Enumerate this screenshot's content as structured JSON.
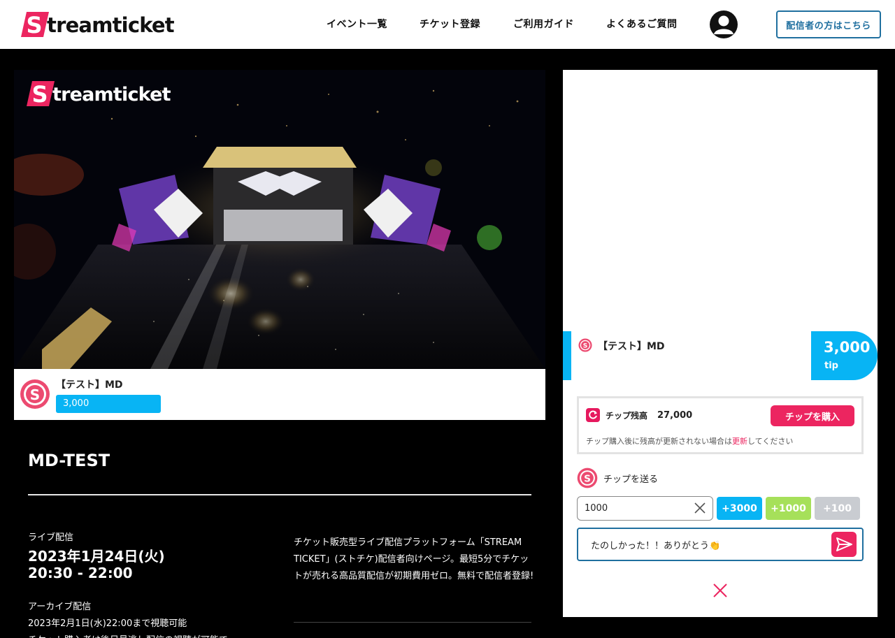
{
  "header": {
    "logo_text": "treamticket",
    "nav": [
      "イベント一覧",
      "チケット登録",
      "ご利用ガイド",
      "よくあるご質問"
    ],
    "cta_label": "配信者の方はこちら"
  },
  "video": {
    "logo_text": "treamticket"
  },
  "tipbar": {
    "name": "【テスト】MD",
    "amount": "3,000"
  },
  "event": {
    "title": "MD-TEST",
    "live_label": "ライブ配信",
    "live_date": "2023年1月24日(火)",
    "live_time": "20:30 - 22:00",
    "archive_label": "アーカイブ配信",
    "archive_text": "2023年2月1日(水)22:00まで視聴可能",
    "archive_note": "チケット購入者は後日見逃し配信の視聴が可能で",
    "description": "チケット販売型ライブ配信プラットフォーム「STREAM TICKET」(ストチケ)配信者向けページ。最短5分でチケットが売れる高品質配信が初期費用ゼロ。無料で配信者登録!"
  },
  "panel": {
    "tip_message": {
      "name": "【テスト】MD",
      "amount": "3,000",
      "unit": "tip"
    },
    "balance": {
      "label": "チップ残高",
      "value": "27,000",
      "buy_label": "チップを購入",
      "note_before": "チップ購入後に残高が更新されない場合は",
      "note_link": "更新",
      "note_after": "してください"
    },
    "send": {
      "label": "チップを送る",
      "amount_value": "1000",
      "add_buttons": [
        "+3000",
        "+1000",
        "+100"
      ],
      "message": "たのしかった！！ありがとう👏"
    }
  },
  "colors": {
    "brand_pink": "#ec2560",
    "accent_blue": "#08b4f4",
    "accent_green": "#a6e05a",
    "muted_gray": "#c9ccd1",
    "cta_blue": "#1f6f9f"
  }
}
